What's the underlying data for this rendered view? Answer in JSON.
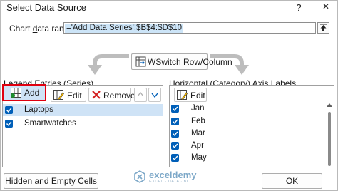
{
  "dialog": {
    "title": "Select Data Source",
    "help_label": "?",
    "close_glyph": "✕"
  },
  "range": {
    "label_prefix": "Chart ",
    "label_accel": "d",
    "label_suffix": "ata range:",
    "value": "='Add Data Series'!$B$4:$D$10",
    "collapse_icon": "upload-arrow-icon"
  },
  "switch": {
    "label_accel": "W",
    "label_rest": "Switch Row/Column"
  },
  "legend": {
    "title_prefix": "Legend Entries (",
    "title_accel": "S",
    "title_suffix": "eries)",
    "add_label": "Add",
    "edit_label": "Edit",
    "remove_label": "Remove",
    "items": [
      {
        "label": "Laptops",
        "checked": true,
        "selected": true
      },
      {
        "label": "Smartwatches",
        "checked": true,
        "selected": false
      }
    ]
  },
  "axis": {
    "title_prefix": "Horizontal (",
    "title_accel": "C",
    "title_suffix": "ategory) Axis Labels",
    "edit_label": "Edit",
    "items": [
      {
        "label": "Jan",
        "checked": true
      },
      {
        "label": "Feb",
        "checked": true
      },
      {
        "label": "Mar",
        "checked": true
      },
      {
        "label": "Apr",
        "checked": true
      },
      {
        "label": "May",
        "checked": true
      }
    ]
  },
  "footer": {
    "hidden_empty_label": "Hidden and Empty Cells",
    "ok_label": "OK",
    "watermark_name": "exceldemy",
    "watermark_sub": "EXCEL · DATA · BI"
  },
  "colors": {
    "accent": "#005fb8",
    "highlight": "#cfe3f6",
    "selection_border": "#e0000f"
  }
}
